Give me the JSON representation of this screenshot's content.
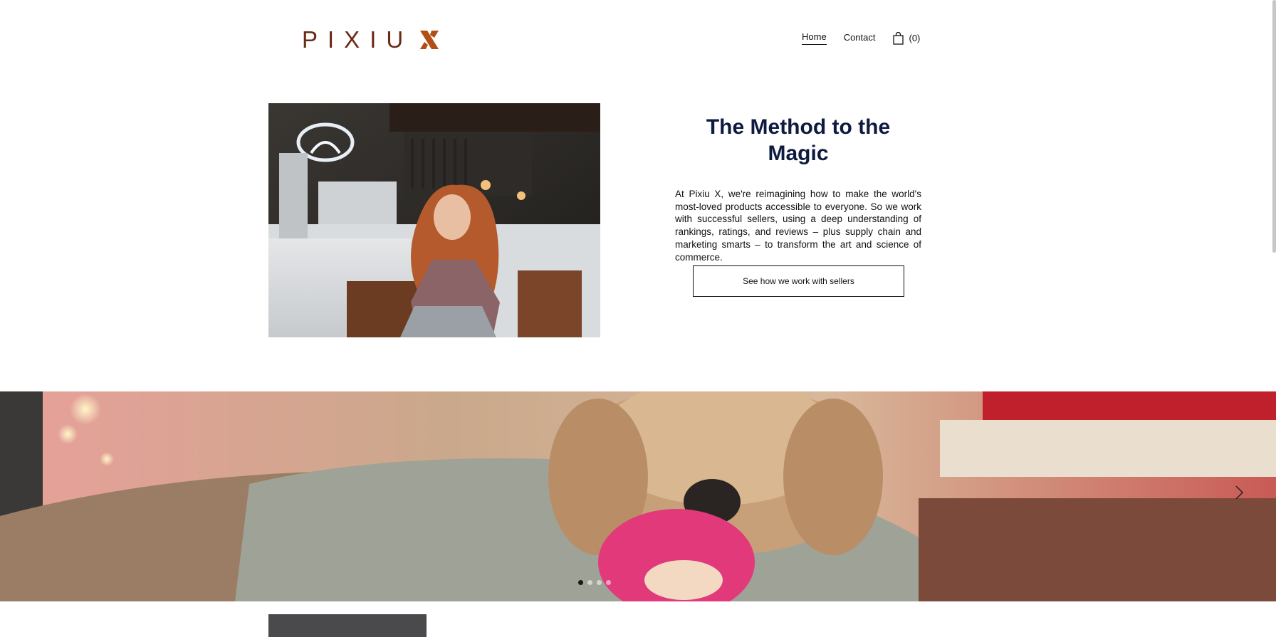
{
  "brand": {
    "logo_text": "PIXIU",
    "logo_mark": "X",
    "color": "#6b2a14",
    "accent": "#b24d14"
  },
  "nav": {
    "home": "Home",
    "contact": "Contact",
    "cart_count": "(0)"
  },
  "feature": {
    "title_line1": "The Method to the",
    "title_line2": "Magic",
    "description": "At Pixiu X, we're reimagining how to make the world's most-loved products accessible to everyone. So we work with successful sellers, using a deep understanding of rankings, ratings, and reviews – plus supply chain and marketing smarts – to transform the art and science of commerce.",
    "cta_label": "See how we work with sellers",
    "title_color": "#0f1a40"
  },
  "slideshow": {
    "slides": 4,
    "active_index": 0
  }
}
